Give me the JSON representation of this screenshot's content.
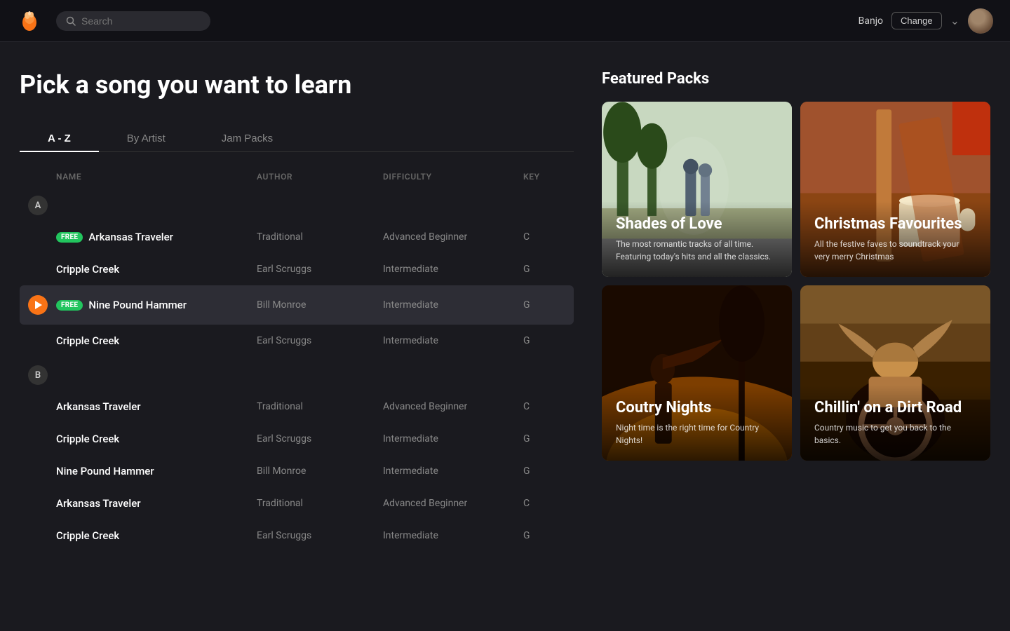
{
  "header": {
    "search_placeholder": "Search",
    "instrument": "Banjo",
    "change_label": "Change"
  },
  "page": {
    "title": "Pick a song you want to learn"
  },
  "tabs": [
    {
      "id": "a-z",
      "label": "A - Z",
      "active": true
    },
    {
      "id": "by-artist",
      "label": "By Artist",
      "active": false
    },
    {
      "id": "jam-packs",
      "label": "Jam Packs",
      "active": false
    }
  ],
  "table": {
    "headers": {
      "col1": "",
      "name": "NAME",
      "author": "AUTHOR",
      "difficulty": "DIFFICULTY",
      "key": "KEY"
    },
    "sections": [
      {
        "letter": "A",
        "songs": [
          {
            "id": 1,
            "name": "Arkansas Traveler",
            "free": true,
            "playing": false,
            "author": "Traditional",
            "difficulty": "Advanced Beginner",
            "key": "C"
          },
          {
            "id": 2,
            "name": "Cripple Creek",
            "free": false,
            "playing": false,
            "author": "Earl Scruggs",
            "difficulty": "Intermediate",
            "key": "G"
          },
          {
            "id": 3,
            "name": "Nine Pound Hammer",
            "free": true,
            "playing": true,
            "author": "Bill Monroe",
            "difficulty": "Intermediate",
            "key": "G"
          },
          {
            "id": 4,
            "name": "Cripple Creek",
            "free": false,
            "playing": false,
            "author": "Earl Scruggs",
            "difficulty": "Intermediate",
            "key": "G"
          }
        ]
      },
      {
        "letter": "B",
        "songs": [
          {
            "id": 5,
            "name": "Arkansas Traveler",
            "free": false,
            "playing": false,
            "author": "Traditional",
            "difficulty": "Advanced Beginner",
            "key": "C"
          },
          {
            "id": 6,
            "name": "Cripple Creek",
            "free": false,
            "playing": false,
            "author": "Earl Scruggs",
            "difficulty": "Intermediate",
            "key": "G"
          },
          {
            "id": 7,
            "name": "Nine Pound Hammer",
            "free": false,
            "playing": false,
            "author": "Bill Monroe",
            "difficulty": "Intermediate",
            "key": "G"
          },
          {
            "id": 8,
            "name": "Arkansas Traveler",
            "free": false,
            "playing": false,
            "author": "Traditional",
            "difficulty": "Advanced Beginner",
            "key": "C"
          },
          {
            "id": 9,
            "name": "Cripple Creek",
            "free": false,
            "playing": false,
            "author": "Earl Scruggs",
            "difficulty": "Intermediate",
            "key": "G"
          }
        ]
      }
    ]
  },
  "featured": {
    "title": "Featured Packs",
    "packs": [
      {
        "id": "shades-of-love",
        "title": "Shades of Love",
        "description": "The most romantic tracks of all time. Featuring today's hits and all the classics.",
        "bg": "shades-love"
      },
      {
        "id": "christmas-favourites",
        "title": "Christmas Favourites",
        "description": "All the festive faves to soundtrack your very merry Christmas",
        "bg": "christmas"
      },
      {
        "id": "country-nights",
        "title": "Coutry Nights",
        "description": "Night time is the right time for Country Nights!",
        "bg": "country-nights"
      },
      {
        "id": "chillin-dirt-road",
        "title": "Chillin' on a Dirt Road",
        "description": "Country music to get you back to the basics.",
        "bg": "chillin"
      }
    ]
  }
}
